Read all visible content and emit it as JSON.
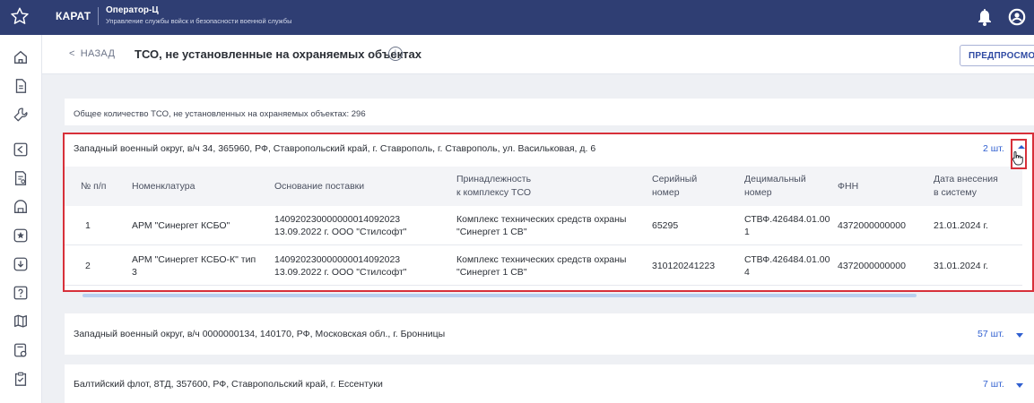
{
  "app": {
    "brand": "КАРАТ",
    "operator_title": "Оператор-Ц",
    "operator_subtitle": "Управление службы войск и безопасности военной службы"
  },
  "header": {
    "back_label": "НАЗАД",
    "page_title": "ТСО, не установленные на охраняемых объектах",
    "preview_label": "ПРЕДПРОСМОТР"
  },
  "summary": {
    "total_text": "Общее количество ТСО, не установленных на охраняемых объектах: 296"
  },
  "groups": [
    {
      "title": "Западный военный округ, в/ч 34, 365960, РФ, Ставропольский край, г. Ставрополь, г. Ставрополь, ул. Васильковая, д. 6",
      "count": "2 шт.",
      "expanded": true
    },
    {
      "title": "Западный военный округ, в/ч 0000000134, 140170, РФ, Московская обл., г. Бронницы",
      "count": "57 шт.",
      "expanded": false
    },
    {
      "title": "Балтийский флот, 8ТД, 357600, РФ, Ставропольский край, г. Ессентуки",
      "count": "7 шт.",
      "expanded": false
    }
  ],
  "table": {
    "columns": [
      "№ п/п",
      "Номенклатура",
      "Основание поставки",
      [
        "Принадлежность",
        "к комплексу ТСО"
      ],
      [
        "Серийный",
        "номер"
      ],
      [
        "Децимальный",
        "номер"
      ],
      "ФНН",
      [
        "Дата внесения",
        "в систему"
      ]
    ],
    "rows": [
      {
        "num": "1",
        "nomenclature": [
          "АРМ \"Синергет КСБО\"",
          ""
        ],
        "basis": [
          "140920230000000014092023",
          "13.09.2022 г. ООО \"Стилсофт\""
        ],
        "belonging": [
          "Комплекс технических средств охраны",
          "\"Синергет 1 СВ\""
        ],
        "serial": "65295",
        "decimal": [
          "СТВФ.426484.01.00",
          "1"
        ],
        "fnn": "4372000000000",
        "date": "21.01.2024 г."
      },
      {
        "num": "2",
        "nomenclature": [
          "АРМ \"Синергет КСБО-К\" тип",
          "3"
        ],
        "basis": [
          "140920230000000014092023",
          "13.09.2022 г. ООО \"Стилсофт\""
        ],
        "belonging": [
          "Комплекс технических средств охраны",
          "\"Синергет 1 СВ\""
        ],
        "serial": "310120241223",
        "decimal": [
          "СТВФ.426484.01.00",
          "4"
        ],
        "fnn": "4372000000000",
        "date": "31.01.2024 г."
      }
    ]
  },
  "colors": {
    "topbar": "#2f3e73",
    "accent": "#2f5fd0",
    "highlight": "#d7303a"
  },
  "icons": {
    "topbar": [
      "star-icon",
      "bell-icon",
      "user-icon"
    ],
    "sidebar": [
      "home-icon",
      "document-icon",
      "wrench-icon",
      "camera-icon",
      "report-icon",
      "dome-icon",
      "badge-icon",
      "download-icon",
      "help-icon",
      "map-icon",
      "settings-doc-icon",
      "clipboard-icon"
    ]
  }
}
